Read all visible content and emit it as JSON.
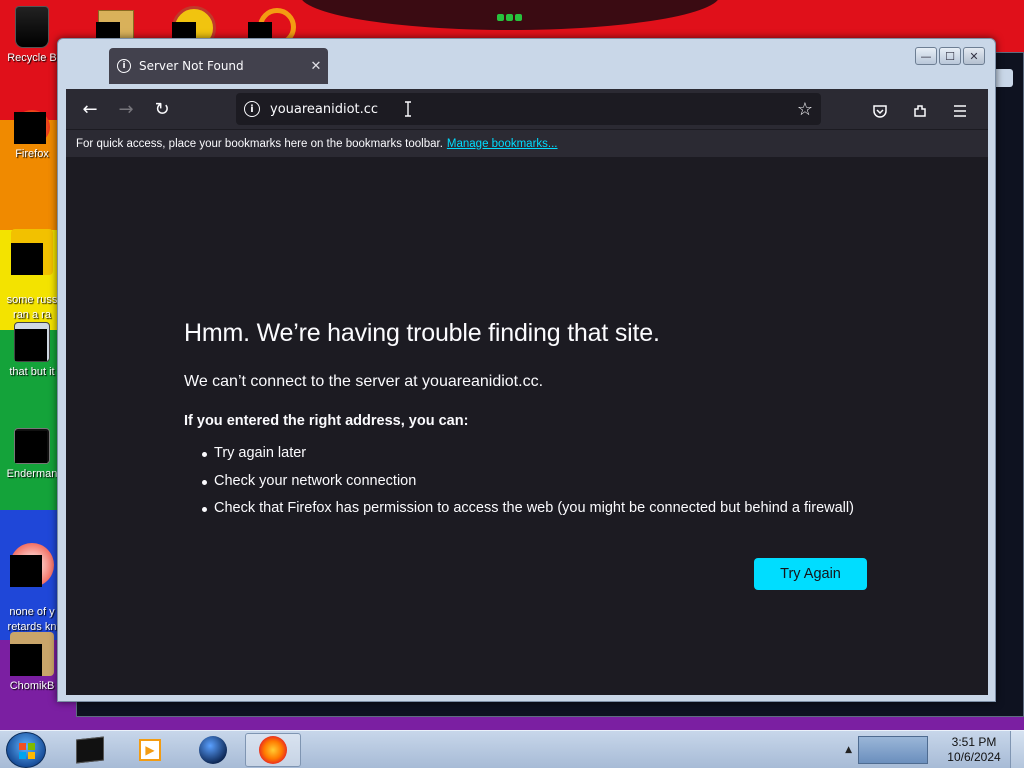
{
  "desktop": {
    "icons": [
      {
        "label": "Recycle B"
      },
      {
        "label": "Firefox"
      },
      {
        "label": "some russ\nran a ra"
      },
      {
        "label": "that but it"
      },
      {
        "label": "Enderman"
      },
      {
        "label": "none of y\nretards kn"
      },
      {
        "label": "ChomikB"
      }
    ]
  },
  "window": {
    "tab_title": "Server Not Found",
    "tab_close": "✕",
    "controls": {
      "minimize": "—",
      "maximize": "☐",
      "close": "✕"
    }
  },
  "navbar": {
    "url": "youareanidiot.cc",
    "back": "←",
    "forward": "→",
    "reload": "↻",
    "star": "☆"
  },
  "bookmarks_bar": {
    "text": "For quick access, place your bookmarks here on the bookmarks toolbar.",
    "link": "Manage bookmarks..."
  },
  "error_page": {
    "title": "Hmm. We’re having trouble finding that site.",
    "description": "We can’t connect to the server at youareanidiot.cc.",
    "subheading": "If you entered the right address, you can:",
    "suggestions": [
      "Try again later",
      "Check your network connection",
      "Check that Firefox has permission to access the web (you might be connected but behind a firewall)"
    ],
    "button": "Try Again"
  },
  "taskbar": {
    "time": "3:51 PM",
    "date": "10/6/2024"
  },
  "colors": {
    "accent": "#00ddff",
    "page_bg": "#1c1b22",
    "toolbar_bg": "#2b2a33"
  }
}
